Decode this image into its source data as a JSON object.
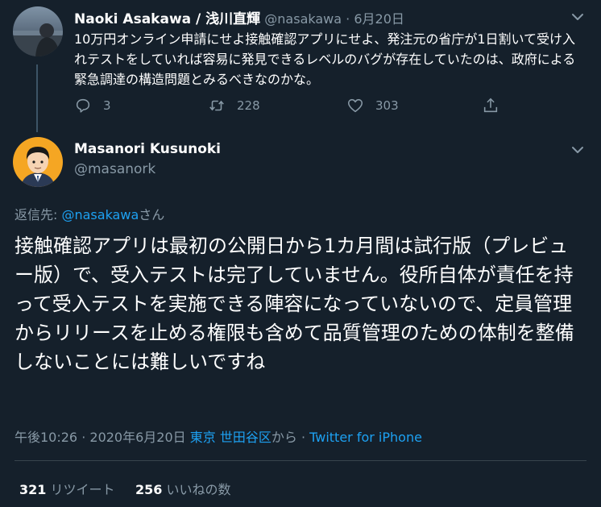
{
  "tweet1": {
    "author_name": "Naoki Asakawa / 浅川直輝",
    "handle": "@nasakawa",
    "separator": "·",
    "date": "6月20日",
    "text": "10万円オンライン申請にせよ接触確認アプリにせよ、発注元の省庁が1日割いて受け入れテストをしていれば容易に発見できるレベルのバグが存在していたのは、政府による緊急調達の構造問題とみるべきなのかな。",
    "replies": "3",
    "retweets": "228",
    "likes": "303"
  },
  "tweet2": {
    "author_name": "Masanori Kusunoki",
    "handle": "@masanork",
    "reply_prefix": "返信先: ",
    "reply_to": "@nasakawa",
    "reply_suffix": "さん",
    "text": "接触確認アプリは最初の公開日から1カ月間は試行版（プレビュー版）で、受入テストは完了していません。役所自体が責任を持って受入テストを実施できる陣容になっていないので、定員管理からリリースを止める権限も含めて品質管理のための体制を整備しないことには難しいですね",
    "time": "午後10:26",
    "meta_sep": " · ",
    "post_date": "2020年6月20日",
    "location": "東京 世田谷区",
    "location_suffix": "から",
    "source": "Twitter for iPhone",
    "retweet_count": "321",
    "retweet_label": "リツイート",
    "like_count": "256",
    "like_label": "いいねの数"
  },
  "colors": {
    "background": "#15202b",
    "muted": "#8899a6",
    "accent": "#1da1f2",
    "divider": "#38444d"
  }
}
